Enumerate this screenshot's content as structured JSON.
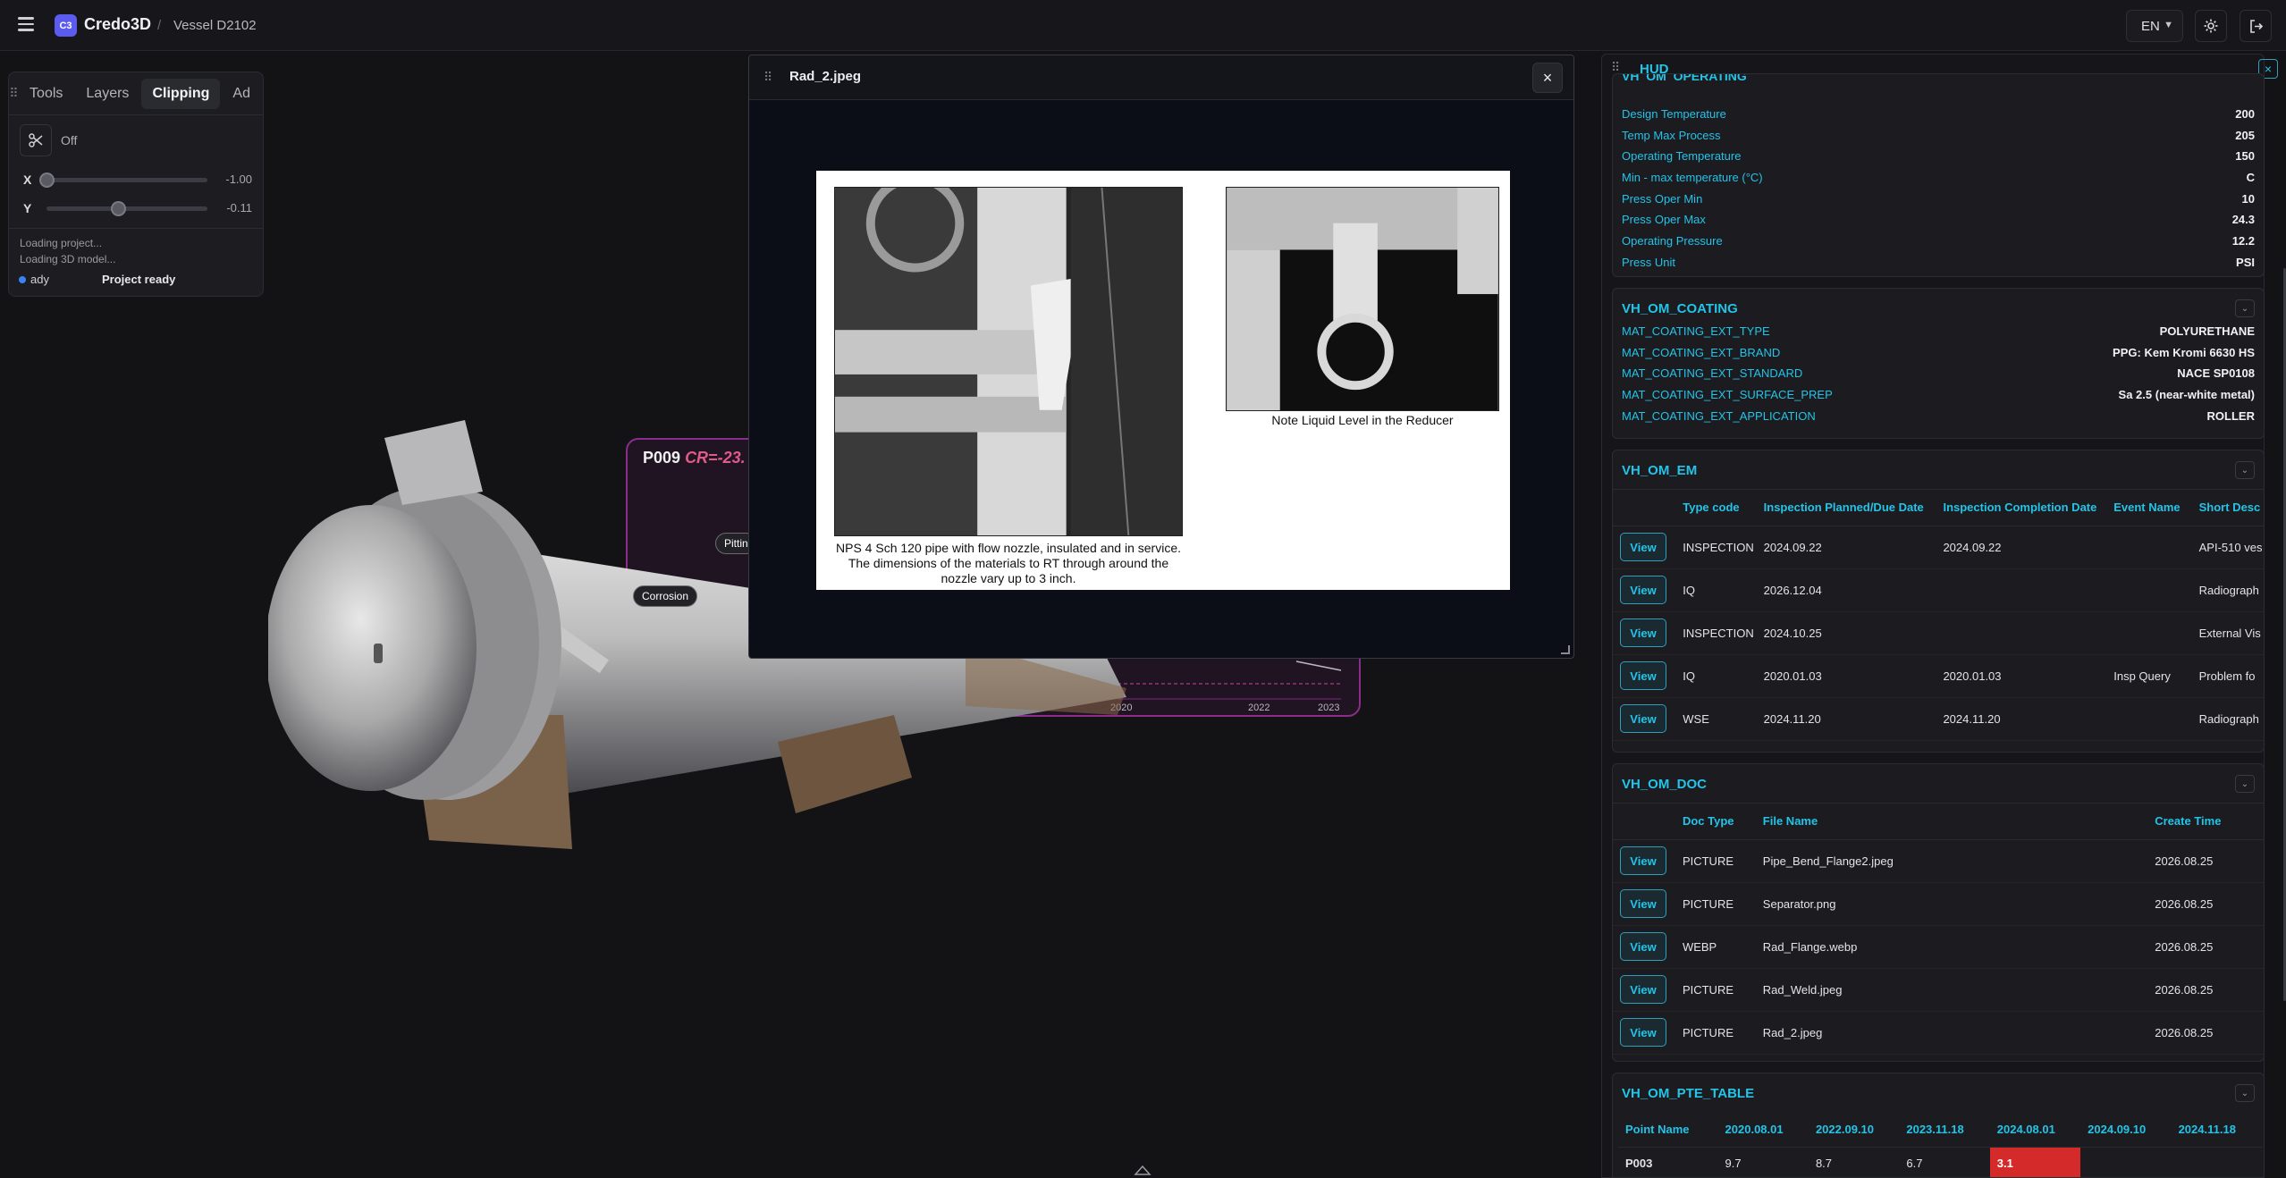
{
  "topbar": {
    "logo": "C3",
    "brand": "Credo3D",
    "separator": "/",
    "breadcrumb": "Vessel D2102",
    "language": "EN"
  },
  "tools_panel": {
    "tabs": [
      "Tools",
      "Layers",
      "Clipping",
      "Ad"
    ],
    "active_tab": "Clipping",
    "clip_state": "Off",
    "sliders": [
      {
        "axis": "X",
        "value": "-1.00",
        "level": 0.0
      },
      {
        "axis": "Y",
        "value": "-0.11",
        "level": 0.445
      }
    ],
    "log": [
      "Loading project...",
      "Loading 3D model..."
    ],
    "status_left": "ady",
    "status_right": "Project ready"
  },
  "scene": {
    "chart_title_point": "P009",
    "chart_title_cr": "CR=-23.",
    "axis_ticks": [
      "2020",
      "2022",
      "2023"
    ],
    "markers": [
      "Corrosion",
      "Pittin"
    ]
  },
  "dialog": {
    "title": "Rad_2.jpeg",
    "close": "×",
    "caption_left": "NPS 4 Sch 120 pipe with flow nozzle, insulated and in service.  The dimensions of the materials to RT through around the nozzle vary up to 3 inch.",
    "caption_right": "Note Liquid Level in the Reducer"
  },
  "hud": {
    "title": "HUD",
    "operating": {
      "title": "VH_OM_OPERATING",
      "rows": [
        {
          "k": "Design Temperature",
          "v": "200"
        },
        {
          "k": "Temp Max Process",
          "v": "205"
        },
        {
          "k": "Operating Temperature",
          "v": "150"
        },
        {
          "k": "Min - max temperature (°C)",
          "v": "C"
        },
        {
          "k": "Press Oper Min",
          "v": "10"
        },
        {
          "k": "Press Oper Max",
          "v": "24.3"
        },
        {
          "k": "Operating Pressure",
          "v": "12.2"
        },
        {
          "k": "Press Unit",
          "v": "PSI"
        }
      ]
    },
    "coating": {
      "title": "VH_OM_COATING",
      "rows": [
        {
          "k": "MAT_COATING_EXT_TYPE",
          "v": "POLYURETHANE"
        },
        {
          "k": "MAT_COATING_EXT_BRAND",
          "v": "PPG: Kem Kromi 6630 HS"
        },
        {
          "k": "MAT_COATING_EXT_STANDARD",
          "v": "NACE SP0108"
        },
        {
          "k": "MAT_COATING_EXT_SURFACE_PREP",
          "v": "Sa 2.5 (near-white metal)"
        },
        {
          "k": "MAT_COATING_EXT_APPLICATION",
          "v": "ROLLER"
        }
      ]
    },
    "em": {
      "title": "VH_OM_EM",
      "columns": [
        "",
        "Type code",
        "Inspection Planned/Due Date",
        "Inspection Completion Date",
        "Event Name",
        "Short Desc"
      ],
      "view_label": "View",
      "rows": [
        [
          "INSPECTION",
          "2024.09.22",
          "2024.09.22",
          "",
          "API-510 ves"
        ],
        [
          "IQ",
          "2026.12.04",
          "",
          "",
          "Radiograph"
        ],
        [
          "INSPECTION",
          "2024.10.25",
          "",
          "",
          "External Vis"
        ],
        [
          "IQ",
          "2020.01.03",
          "2020.01.03",
          "Insp Query",
          "Problem fo"
        ],
        [
          "WSE",
          "2024.11.20",
          "2024.11.20",
          "",
          "Radiograph"
        ]
      ]
    },
    "doc": {
      "title": "VH_OM_DOC",
      "columns": [
        "",
        "Doc Type",
        "File Name",
        "Create Time"
      ],
      "view_label": "View",
      "rows": [
        [
          "PICTURE",
          "Pipe_Bend_Flange2.jpeg",
          "2026.08.25"
        ],
        [
          "PICTURE",
          "Separator.png",
          "2026.08.25"
        ],
        [
          "WEBP",
          "Rad_Flange.webp",
          "2026.08.25"
        ],
        [
          "PICTURE",
          "Rad_Weld.jpeg",
          "2026.08.25"
        ],
        [
          "PICTURE",
          "Rad_2.jpeg",
          "2026.08.25"
        ]
      ]
    },
    "pte": {
      "title": "VH_OM_PTE_TABLE",
      "columns": [
        "Point Name",
        "2020.08.01",
        "2022.09.10",
        "2023.11.18",
        "2024.08.01",
        "2024.09.10",
        "2024.11.18"
      ],
      "rows": [
        [
          "P003",
          "9.7",
          "8.7",
          "6.7",
          "3.1",
          "",
          ""
        ]
      ],
      "highlight_color": "#d42a2a"
    }
  }
}
